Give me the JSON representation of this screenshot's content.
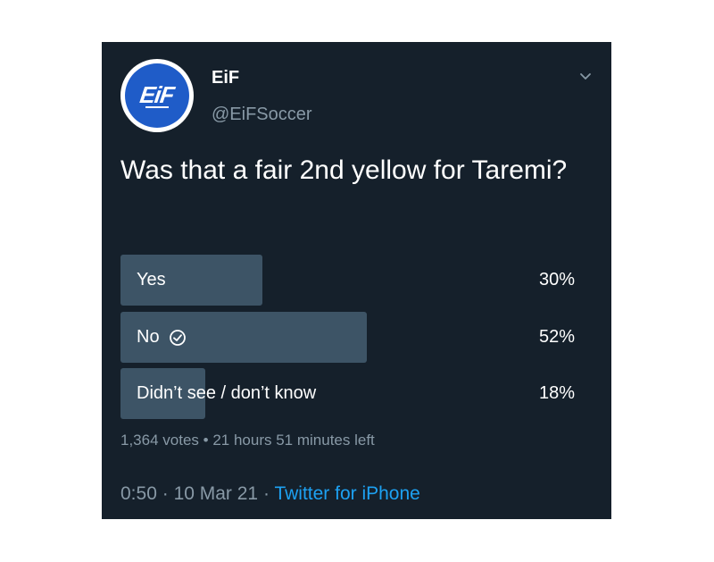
{
  "tweet": {
    "avatar_text": "EiF",
    "name": "EiF",
    "handle": "@EiFSoccer",
    "question": "Was that a fair 2nd yellow for Taremi?",
    "colors": {
      "background": "#15202b",
      "bar": "#3d5466",
      "muted": "#8899a6",
      "link": "#1da1f2",
      "avatar": "#1f5cc8"
    }
  },
  "poll": {
    "options": [
      {
        "label": "Yes",
        "percent_text": "30%",
        "fraction": 0.3,
        "voted": false
      },
      {
        "label": "No",
        "percent_text": "52%",
        "fraction": 0.52,
        "voted": true
      },
      {
        "label": "Didn’t see / don’t know",
        "percent_text": "18%",
        "fraction": 0.18,
        "voted": false
      }
    ],
    "votes": "1,364 votes",
    "separator": "•",
    "time_left": "21 hours 51 minutes left"
  },
  "footer": {
    "time": "0:50",
    "dot1": "·",
    "date": "10 Mar 21",
    "dot2": "·",
    "source": "Twitter for iPhone"
  }
}
